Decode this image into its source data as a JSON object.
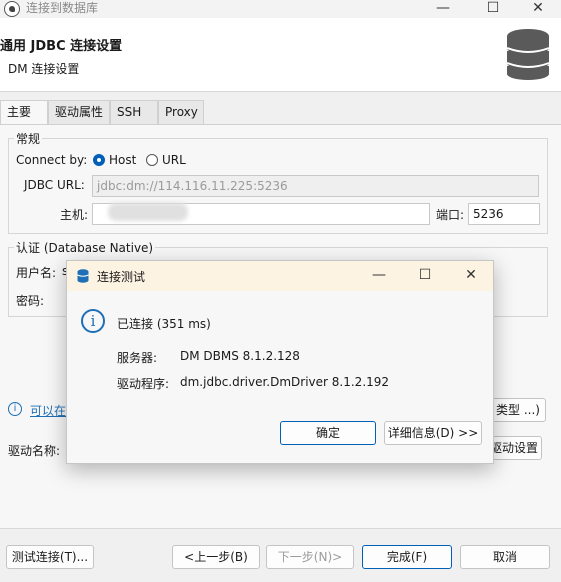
{
  "window": {
    "title": "连接到数据库",
    "minimize": "—",
    "maximize": "☐",
    "close": "✕"
  },
  "header": {
    "title": "通用 JDBC 连接设置",
    "subtitle": "DM 连接设置"
  },
  "tabs": [
    "主要",
    "驱动属性",
    "SSH",
    "Proxy"
  ],
  "general": {
    "legend": "常规",
    "connect_by_label": "Connect by:",
    "host_option": "Host",
    "url_option": "URL",
    "jdbc_url_label": "JDBC URL:",
    "jdbc_url_value": "jdbc:dm://114.116.11.225:5236",
    "host_label": "主机:",
    "port_label": "端口:",
    "port_value": "5236"
  },
  "auth": {
    "legend": "认证 (Database Native)",
    "username_label": "用户名:",
    "username_value": "s",
    "password_label": "密码:"
  },
  "info_link": "可以在",
  "driver": {
    "label": "驱动名称:",
    "type_button": "类型 ...)",
    "settings_button": "驱动设置"
  },
  "dialog": {
    "title": "连接测试",
    "status": "已连接 (351 ms)",
    "server_label": "服务器:",
    "server_value": "DM DBMS 8.1.2.128",
    "driver_label": "驱动程序:",
    "driver_value": "dm.jdbc.driver.DmDriver 8.1.2.192",
    "ok_button": "确定",
    "details_button": "详细信息(D) >>"
  },
  "footer": {
    "test_button": "测试连接(T)...",
    "back_button": "<上一步(B)",
    "next_button": "下一步(N)>",
    "finish_button": "完成(F)",
    "cancel_button": "取消"
  },
  "colors": {
    "accent": "#005fb8",
    "link": "#1e6fb5",
    "dialog_title_bg": "#fdf3e3"
  }
}
